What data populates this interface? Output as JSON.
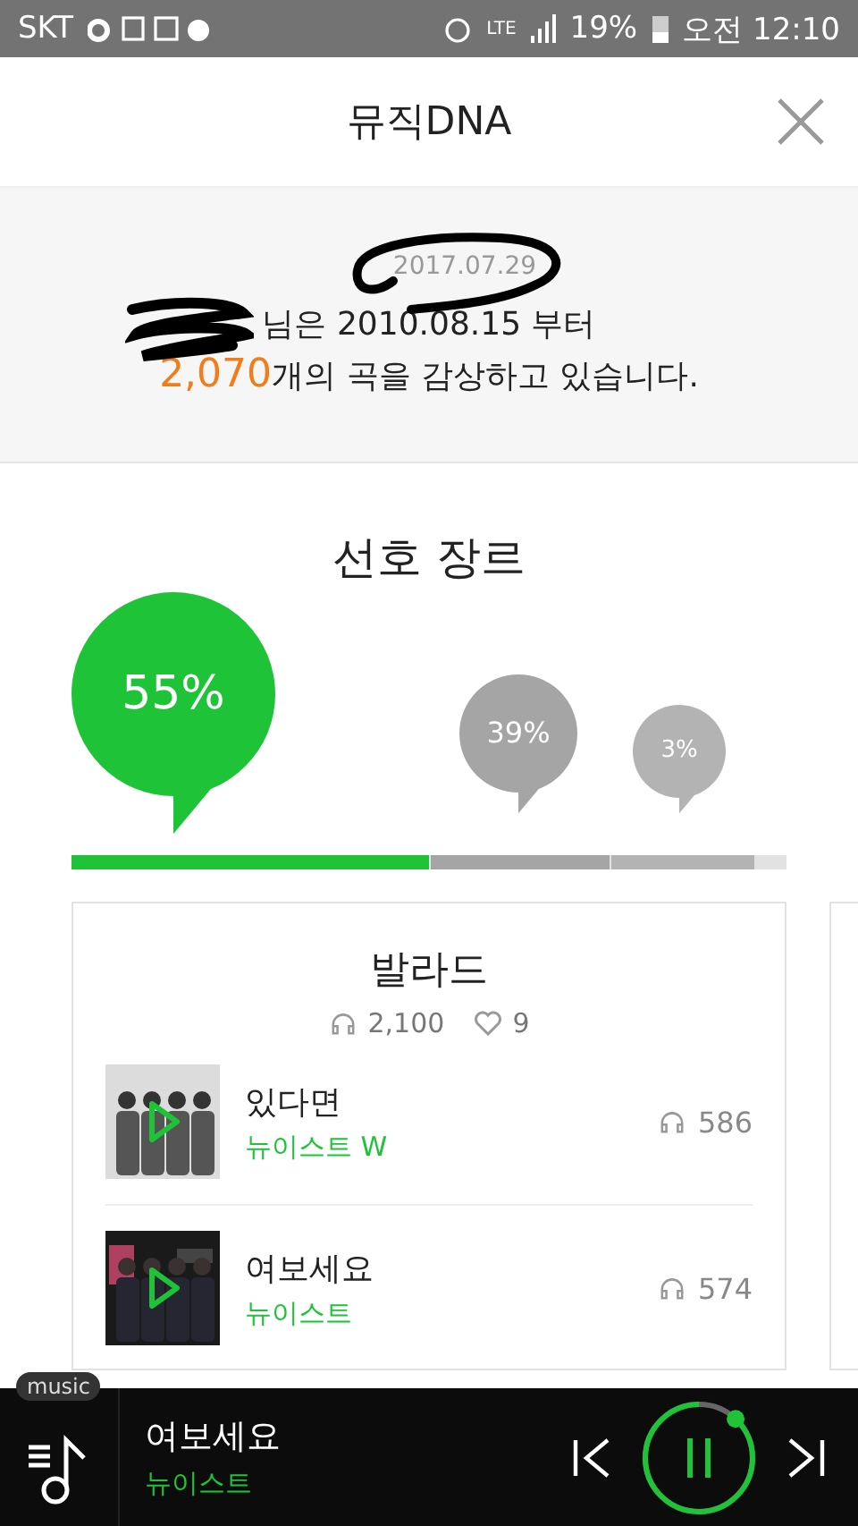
{
  "status_bar": {
    "carrier": "SKT",
    "network": "LTE",
    "battery": "19%",
    "time": "오전 12:10"
  },
  "header": {
    "title": "뮤직DNA"
  },
  "summary": {
    "date": "2017.07.29",
    "since_line": "님은 2010.08.15 부터",
    "count": "2,070",
    "count_suffix": "개의 곡을 감상하고 있습니다."
  },
  "genres": {
    "title": "선호 장르",
    "items": [
      {
        "percent": "55%",
        "color": "#1ec337"
      },
      {
        "percent": "39%",
        "color": "#a5a5a5"
      },
      {
        "percent": "3%",
        "color": "#b3b3b3"
      }
    ]
  },
  "genre_card": {
    "name": "발라드",
    "plays": "2,100",
    "likes": "9",
    "songs": [
      {
        "title": "있다면",
        "artist": "뉴이스트 W",
        "plays": "586"
      },
      {
        "title": "여보세요",
        "artist": "뉴이스트",
        "plays": "574"
      }
    ]
  },
  "player": {
    "badge": "music",
    "title": "여보세요",
    "artist": "뉴이스트",
    "level": 0.88
  }
}
